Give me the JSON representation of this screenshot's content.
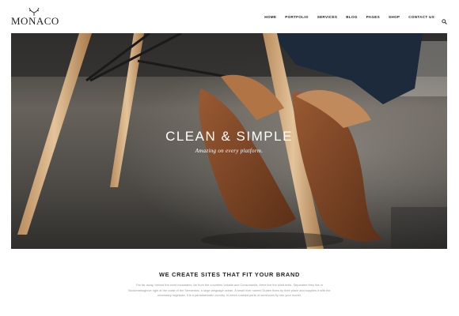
{
  "header": {
    "logo_text": "MONACO",
    "logo_icon": "antlers-icon",
    "nav": [
      {
        "label": "HOME"
      },
      {
        "label": "PORTFOLIO"
      },
      {
        "label": "SERVICES"
      },
      {
        "label": "BLOG"
      },
      {
        "label": "PAGES"
      },
      {
        "label": "SHOP"
      },
      {
        "label": "CONTACT US"
      }
    ],
    "search_icon": "search-icon"
  },
  "hero": {
    "title": "CLEAN & SIMPLE",
    "subtitle": "Amazing on every platform."
  },
  "section": {
    "title": "WE CREATE SITES THAT FIT YOUR BRAND",
    "body": "Far far away, behind the word mountains, far from the countries Vokalia and Consonantia, there live the blind texts. Separated they live in Bookmarksgrove right at the coast of the Semantics, a large language ocean. A small river named Duden flows by their place and supplies it with the necessary regelialia. It is a paradisematic country, in which roasted parts of sentences fly into your mouth."
  },
  "colors": {
    "text": "#222222",
    "muted": "#999999",
    "background": "#ffffff"
  }
}
